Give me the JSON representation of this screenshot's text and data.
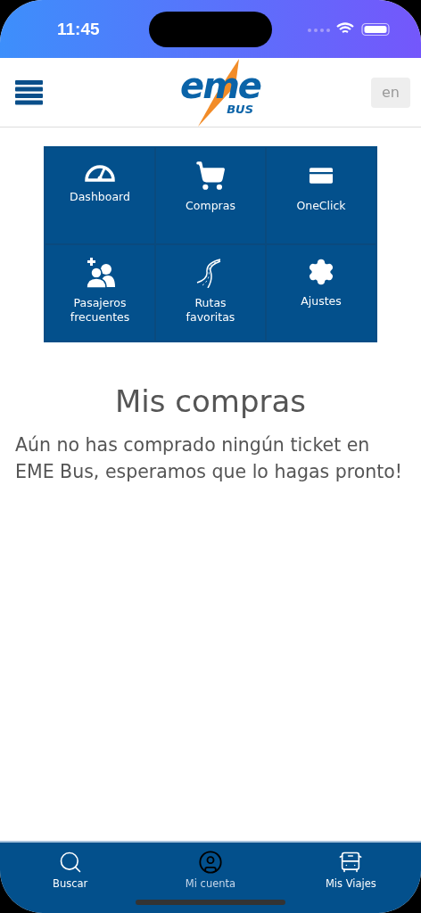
{
  "status_bar": {
    "time": "11:45"
  },
  "header": {
    "logo": {
      "word": "eme",
      "sub": "BUS"
    },
    "language_button": "en"
  },
  "menu": [
    {
      "kind": "gauge",
      "label": "Dashboard"
    },
    {
      "kind": "cart",
      "label": "Compras"
    },
    {
      "kind": "card",
      "label": "OneClick"
    },
    {
      "kind": "people",
      "label": "Pasajeros frecuentes"
    },
    {
      "kind": "road",
      "label": "Rutas favoritas"
    },
    {
      "kind": "gear",
      "label": "Ajustes"
    }
  ],
  "title": "Mis compras",
  "message": "Aún no has comprado ningún ticket en EME Bus, esperamos que lo hagas pronto!",
  "bottom_nav": [
    {
      "kind": "search",
      "label": "Buscar",
      "selected": false
    },
    {
      "kind": "account",
      "label": "Mi cuenta",
      "selected": true
    },
    {
      "kind": "bus",
      "label": "Mis Viajes",
      "selected": false
    }
  ]
}
